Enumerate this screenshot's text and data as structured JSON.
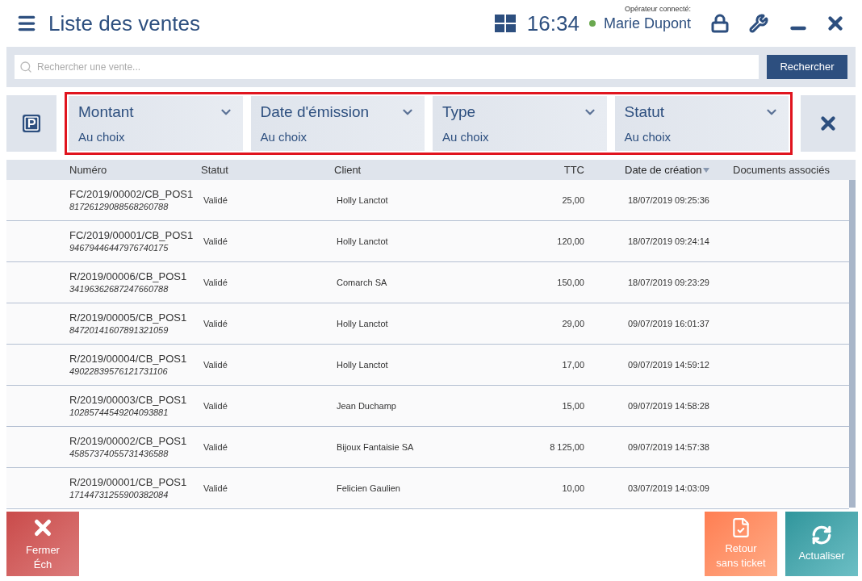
{
  "header": {
    "title": "Liste des ventes",
    "time": "16:34",
    "operator_label": "Opérateur connecté:",
    "operator_name": "Marie Dupont",
    "online": true
  },
  "search": {
    "placeholder": "Rechercher une vente...",
    "button": "Rechercher"
  },
  "filters": [
    {
      "label": "Montant",
      "value": "Au choix"
    },
    {
      "label": "Date d'émission",
      "value": "Au choix"
    },
    {
      "label": "Type",
      "value": "Au choix"
    },
    {
      "label": "Statut",
      "value": "Au choix"
    }
  ],
  "table": {
    "columns": [
      {
        "label": "Numéro",
        "sorted": false
      },
      {
        "label": "Statut",
        "sorted": false
      },
      {
        "label": "Client",
        "sorted": false
      },
      {
        "label": "TTC",
        "sorted": false
      },
      {
        "label": "Date de création",
        "sorted": true
      },
      {
        "label": "Documents associés",
        "sorted": false
      }
    ],
    "rows": [
      {
        "number": "FC/2019/00002/CB_POS1",
        "code": "81726129088568260788",
        "status": "Validé",
        "client": "Holly Lanctot",
        "ttc": "25,00",
        "date": "18/07/2019 09:25:36"
      },
      {
        "number": "FC/2019/00001/CB_POS1",
        "code": "94679446447976740175",
        "status": "Validé",
        "client": "Holly Lanctot",
        "ttc": "120,00",
        "date": "18/07/2019 09:24:14"
      },
      {
        "number": "R/2019/00006/CB_POS1",
        "code": "34196362687247660788",
        "status": "Validé",
        "client": "Comarch SA",
        "ttc": "150,00",
        "date": "18/07/2019 09:23:29"
      },
      {
        "number": "R/2019/00005/CB_POS1",
        "code": "84720141607891321059",
        "status": "Validé",
        "client": "Holly Lanctot",
        "ttc": "29,00",
        "date": "09/07/2019 16:01:37"
      },
      {
        "number": "R/2019/00004/CB_POS1",
        "code": "49022839576121731106",
        "status": "Validé",
        "client": "Holly Lanctot",
        "ttc": "17,00",
        "date": "09/07/2019 14:59:12"
      },
      {
        "number": "R/2019/00003/CB_POS1",
        "code": "10285744549204093881",
        "status": "Validé",
        "client": "Jean Duchamp",
        "ttc": "15,00",
        "date": "09/07/2019 14:58:28"
      },
      {
        "number": "R/2019/00002/CB_POS1",
        "code": "45857374055731436588",
        "status": "Validé",
        "client": "Bijoux Fantaisie SA",
        "ttc": "8 125,00",
        "date": "09/07/2019 14:57:38"
      },
      {
        "number": "R/2019/00001/CB_POS1",
        "code": "17144731255900382084",
        "status": "Validé",
        "client": "Felicien Gaulien",
        "ttc": "10,00",
        "date": "03/07/2019 14:03:09"
      }
    ]
  },
  "actions": [
    {
      "kind": "close",
      "label": "Fermer Éch"
    },
    {
      "kind": "return",
      "label": "Retour sans ticket"
    },
    {
      "kind": "refresh",
      "label": "Actualiser"
    }
  ]
}
